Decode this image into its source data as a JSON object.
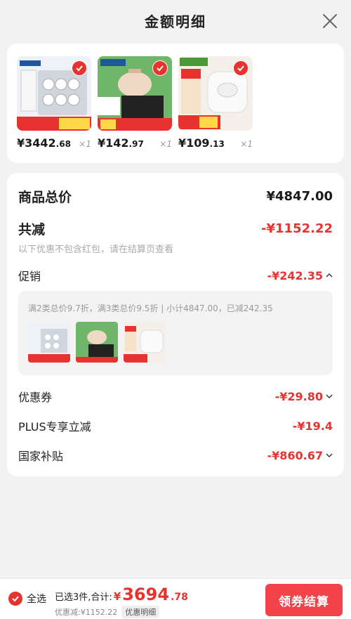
{
  "header": {
    "title": "金额明细"
  },
  "products": [
    {
      "price_int": "¥3442",
      "price_dec": ".68",
      "qty": "×1"
    },
    {
      "price_int": "¥142",
      "price_dec": ".97",
      "qty": "×1"
    },
    {
      "price_int": "¥109",
      "price_dec": ".13",
      "qty": "×1"
    }
  ],
  "summary": {
    "total_label": "商品总价",
    "total_value": "¥4847.00",
    "reduce_label": "共减",
    "reduce_value": "-¥1152.22",
    "reduce_note": "以下优惠不包含红包，请在结算页查看",
    "promo_label": "促销",
    "promo_value": "-¥242.35",
    "promo_detail": "满2类总价9.7折，满3类总价9.5折 | 小计4847.00，已减242.35",
    "coupon_label": "优惠券",
    "coupon_value": "-¥29.80",
    "plus_label": "PLUS专享立减",
    "plus_value": "-¥19.4",
    "subsidy_label": "国家补贴",
    "subsidy_value": "-¥860.67"
  },
  "bottom": {
    "select_all": "全选",
    "total_prefix": "已选3件,合计:",
    "total_sym": "¥",
    "total_int": "3694",
    "total_dec": ".78",
    "discount_text": "优惠减:¥1152.22",
    "detail_chip": "优惠明细",
    "checkout": "领券结算"
  },
  "colors": {
    "accent": "#e8322f",
    "button": "#f2434a"
  },
  "icons": {
    "close": "close-icon",
    "check": "check-icon",
    "chevron_up": "chevron-up-icon",
    "chevron_down": "chevron-down-icon"
  }
}
